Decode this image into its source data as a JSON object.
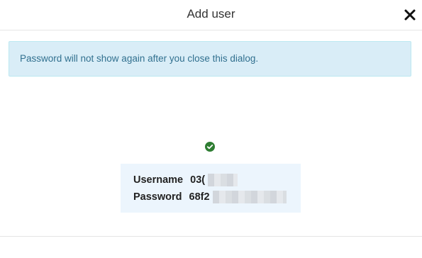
{
  "dialog": {
    "title": "Add user",
    "close_icon": "close-icon"
  },
  "alert": {
    "message": "Password will not show again after you close this dialog."
  },
  "status": {
    "icon": "check-circle-icon",
    "color": "#2e7d32"
  },
  "credentials": {
    "username_label": "Username",
    "username_value_visible": "03(",
    "password_label": "Password",
    "password_value_visible": "68f2"
  },
  "colors": {
    "alert_background": "#d9edf7",
    "alert_text": "#31708f",
    "credentials_background": "#ecf5fd"
  }
}
